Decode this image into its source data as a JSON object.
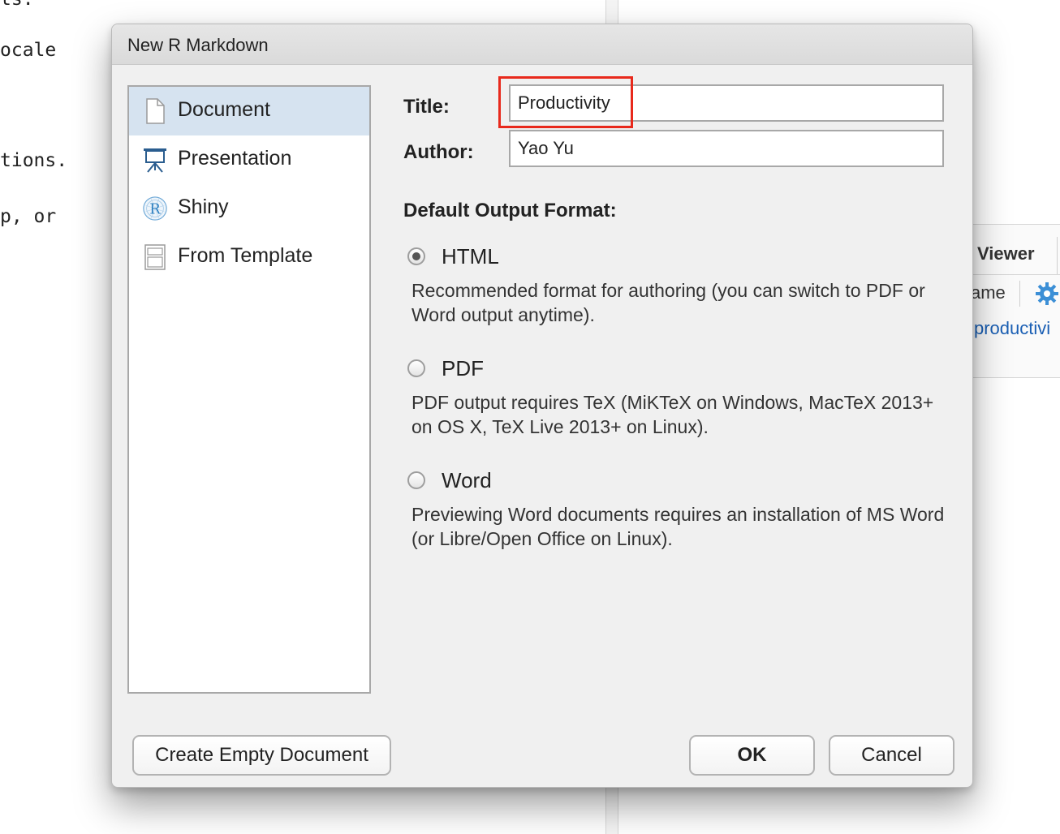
{
  "background": {
    "code_lines": [
      "ts.",
      "ocale",
      "tions.",
      "p, or"
    ],
    "viewer_tab": "Viewer",
    "name_fragment": "ame",
    "link_fragment": "productivi",
    "gear": "gear-icon"
  },
  "dialog": {
    "title": "New R Markdown",
    "types": [
      {
        "label": "Document",
        "icon": "document-icon",
        "selected": true
      },
      {
        "label": "Presentation",
        "icon": "presentation-icon",
        "selected": false
      },
      {
        "label": "Shiny",
        "icon": "shiny-r-icon",
        "selected": false
      },
      {
        "label": "From Template",
        "icon": "template-icon",
        "selected": false
      }
    ],
    "title_label": "Title:",
    "title_value": "Productivity",
    "author_label": "Author:",
    "author_value": "Yao Yu",
    "format_heading": "Default Output Format:",
    "formats": [
      {
        "label": "HTML",
        "checked": true,
        "desc": "Recommended format for authoring (you can switch to PDF or Word output anytime)."
      },
      {
        "label": "PDF",
        "checked": false,
        "desc": "PDF output requires TeX (MiKTeX on Windows, MacTeX 2013+ on OS X, TeX Live 2013+ on Linux)."
      },
      {
        "label": "Word",
        "checked": false,
        "desc": "Previewing Word documents requires an installation of MS Word (or Libre/Open Office on Linux)."
      }
    ],
    "buttons": {
      "create_empty": "Create Empty Document",
      "ok": "OK",
      "cancel": "Cancel"
    },
    "highlight_color": "#e8291c",
    "selected_bg": "#d6e3f0"
  }
}
